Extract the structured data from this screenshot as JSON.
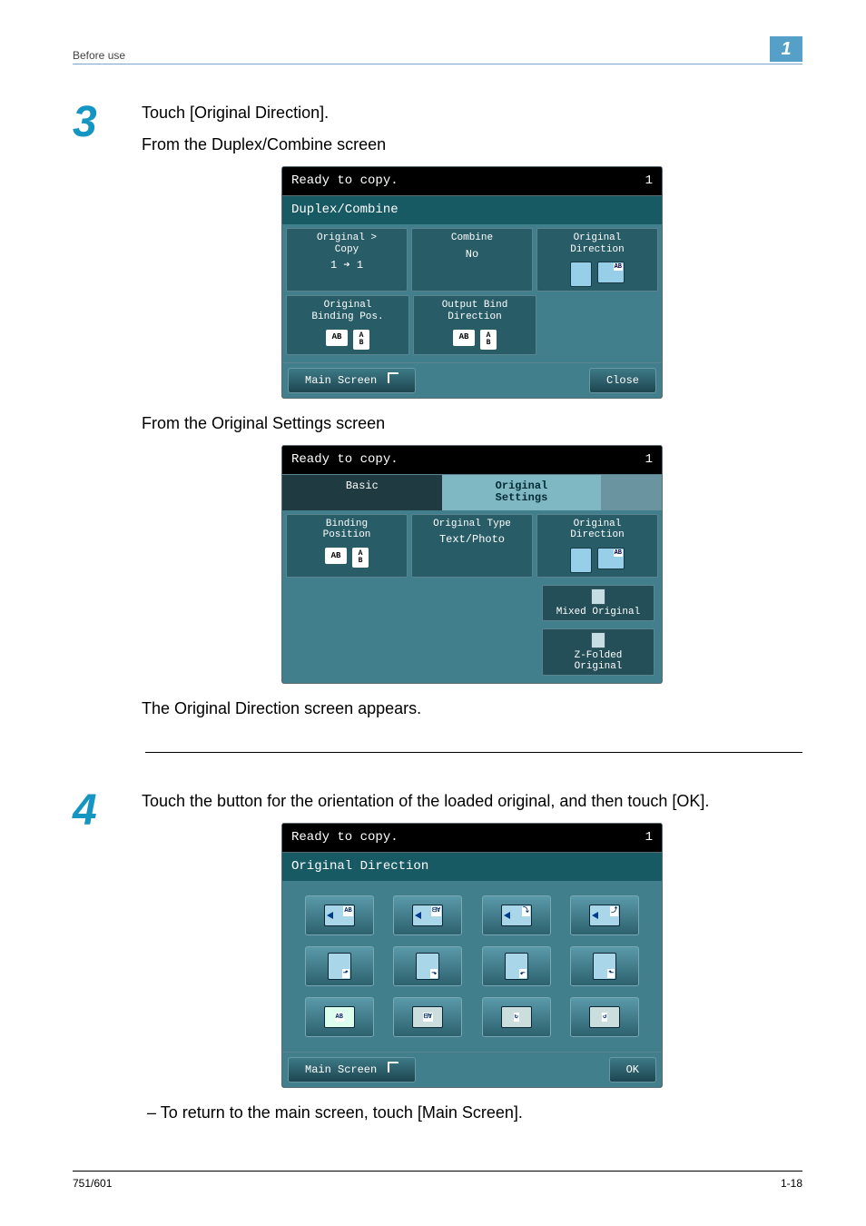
{
  "header": {
    "section_title": "Before use",
    "chapter_number": "1"
  },
  "steps": {
    "s3": {
      "num": "3",
      "line1": "Touch [Original Direction].",
      "line2": "From the Duplex/Combine screen",
      "line3": "From the Original Settings screen",
      "line4": "The Original Direction screen appears."
    },
    "s4": {
      "num": "4",
      "line1": "Touch the button for the orientation of the loaded original, and then touch [OK].",
      "bullet": "To return to the main screen, touch [Main Screen]."
    }
  },
  "screen1": {
    "status": "Ready to copy.",
    "counter": "1",
    "title": "Duplex/Combine",
    "cells": {
      "orig_copy_lbl": "Original >\nCopy",
      "orig_copy_val": "1 ➔ 1",
      "combine_lbl": "Combine",
      "combine_val": "No",
      "orig_dir_lbl": "Original\nDirection",
      "bind_pos_lbl": "Original\nBinding Pos.",
      "out_bind_lbl": "Output Bind\nDirection"
    },
    "buttons": {
      "main_screen": "Main Screen",
      "close": "Close"
    }
  },
  "screen2": {
    "status": "Ready to copy.",
    "counter": "1",
    "tabs": {
      "basic": "Basic",
      "original_settings": "Original\nSettings"
    },
    "cells": {
      "bind_pos_lbl": "Binding\nPosition",
      "orig_type_lbl": "Original Type",
      "orig_type_val": "Text/Photo",
      "orig_dir_lbl": "Original\nDirection"
    },
    "options": {
      "mixed": "Mixed Original",
      "zfold": "Z-Folded\nOriginal"
    }
  },
  "screen3": {
    "status": "Ready to copy.",
    "counter": "1",
    "title": "Original Direction",
    "buttons": {
      "main_screen": "Main Screen",
      "ok": "OK"
    }
  },
  "footer": {
    "left": "751/601",
    "right": "1-18"
  }
}
